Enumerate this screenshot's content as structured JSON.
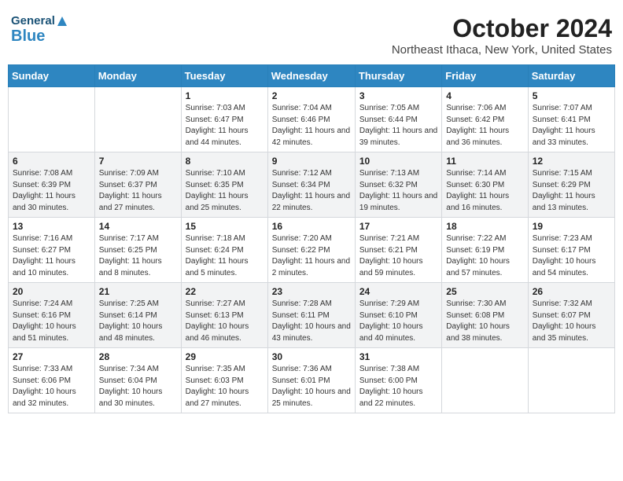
{
  "header": {
    "logo_general": "General",
    "logo_blue": "Blue",
    "title": "October 2024",
    "subtitle": "Northeast Ithaca, New York, United States"
  },
  "weekdays": [
    "Sunday",
    "Monday",
    "Tuesday",
    "Wednesday",
    "Thursday",
    "Friday",
    "Saturday"
  ],
  "weeks": [
    [
      {
        "day": "",
        "info": ""
      },
      {
        "day": "",
        "info": ""
      },
      {
        "day": "1",
        "info": "Sunrise: 7:03 AM\nSunset: 6:47 PM\nDaylight: 11 hours and 44 minutes."
      },
      {
        "day": "2",
        "info": "Sunrise: 7:04 AM\nSunset: 6:46 PM\nDaylight: 11 hours and 42 minutes."
      },
      {
        "day": "3",
        "info": "Sunrise: 7:05 AM\nSunset: 6:44 PM\nDaylight: 11 hours and 39 minutes."
      },
      {
        "day": "4",
        "info": "Sunrise: 7:06 AM\nSunset: 6:42 PM\nDaylight: 11 hours and 36 minutes."
      },
      {
        "day": "5",
        "info": "Sunrise: 7:07 AM\nSunset: 6:41 PM\nDaylight: 11 hours and 33 minutes."
      }
    ],
    [
      {
        "day": "6",
        "info": "Sunrise: 7:08 AM\nSunset: 6:39 PM\nDaylight: 11 hours and 30 minutes."
      },
      {
        "day": "7",
        "info": "Sunrise: 7:09 AM\nSunset: 6:37 PM\nDaylight: 11 hours and 27 minutes."
      },
      {
        "day": "8",
        "info": "Sunrise: 7:10 AM\nSunset: 6:35 PM\nDaylight: 11 hours and 25 minutes."
      },
      {
        "day": "9",
        "info": "Sunrise: 7:12 AM\nSunset: 6:34 PM\nDaylight: 11 hours and 22 minutes."
      },
      {
        "day": "10",
        "info": "Sunrise: 7:13 AM\nSunset: 6:32 PM\nDaylight: 11 hours and 19 minutes."
      },
      {
        "day": "11",
        "info": "Sunrise: 7:14 AM\nSunset: 6:30 PM\nDaylight: 11 hours and 16 minutes."
      },
      {
        "day": "12",
        "info": "Sunrise: 7:15 AM\nSunset: 6:29 PM\nDaylight: 11 hours and 13 minutes."
      }
    ],
    [
      {
        "day": "13",
        "info": "Sunrise: 7:16 AM\nSunset: 6:27 PM\nDaylight: 11 hours and 10 minutes."
      },
      {
        "day": "14",
        "info": "Sunrise: 7:17 AM\nSunset: 6:25 PM\nDaylight: 11 hours and 8 minutes."
      },
      {
        "day": "15",
        "info": "Sunrise: 7:18 AM\nSunset: 6:24 PM\nDaylight: 11 hours and 5 minutes."
      },
      {
        "day": "16",
        "info": "Sunrise: 7:20 AM\nSunset: 6:22 PM\nDaylight: 11 hours and 2 minutes."
      },
      {
        "day": "17",
        "info": "Sunrise: 7:21 AM\nSunset: 6:21 PM\nDaylight: 10 hours and 59 minutes."
      },
      {
        "day": "18",
        "info": "Sunrise: 7:22 AM\nSunset: 6:19 PM\nDaylight: 10 hours and 57 minutes."
      },
      {
        "day": "19",
        "info": "Sunrise: 7:23 AM\nSunset: 6:17 PM\nDaylight: 10 hours and 54 minutes."
      }
    ],
    [
      {
        "day": "20",
        "info": "Sunrise: 7:24 AM\nSunset: 6:16 PM\nDaylight: 10 hours and 51 minutes."
      },
      {
        "day": "21",
        "info": "Sunrise: 7:25 AM\nSunset: 6:14 PM\nDaylight: 10 hours and 48 minutes."
      },
      {
        "day": "22",
        "info": "Sunrise: 7:27 AM\nSunset: 6:13 PM\nDaylight: 10 hours and 46 minutes."
      },
      {
        "day": "23",
        "info": "Sunrise: 7:28 AM\nSunset: 6:11 PM\nDaylight: 10 hours and 43 minutes."
      },
      {
        "day": "24",
        "info": "Sunrise: 7:29 AM\nSunset: 6:10 PM\nDaylight: 10 hours and 40 minutes."
      },
      {
        "day": "25",
        "info": "Sunrise: 7:30 AM\nSunset: 6:08 PM\nDaylight: 10 hours and 38 minutes."
      },
      {
        "day": "26",
        "info": "Sunrise: 7:32 AM\nSunset: 6:07 PM\nDaylight: 10 hours and 35 minutes."
      }
    ],
    [
      {
        "day": "27",
        "info": "Sunrise: 7:33 AM\nSunset: 6:06 PM\nDaylight: 10 hours and 32 minutes."
      },
      {
        "day": "28",
        "info": "Sunrise: 7:34 AM\nSunset: 6:04 PM\nDaylight: 10 hours and 30 minutes."
      },
      {
        "day": "29",
        "info": "Sunrise: 7:35 AM\nSunset: 6:03 PM\nDaylight: 10 hours and 27 minutes."
      },
      {
        "day": "30",
        "info": "Sunrise: 7:36 AM\nSunset: 6:01 PM\nDaylight: 10 hours and 25 minutes."
      },
      {
        "day": "31",
        "info": "Sunrise: 7:38 AM\nSunset: 6:00 PM\nDaylight: 10 hours and 22 minutes."
      },
      {
        "day": "",
        "info": ""
      },
      {
        "day": "",
        "info": ""
      }
    ]
  ]
}
